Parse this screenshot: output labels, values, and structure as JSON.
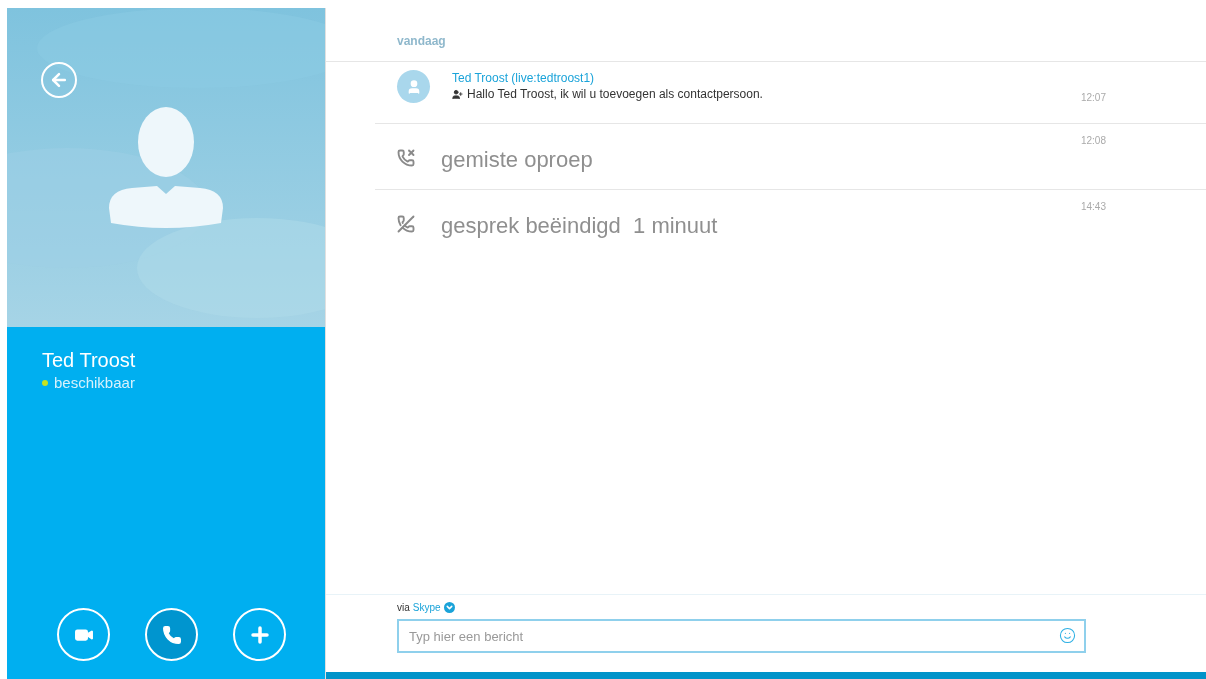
{
  "contact": {
    "name": "Ted Troost",
    "status": "beschikbaar",
    "available": true
  },
  "actions": [
    {
      "kind": "video",
      "selected": false
    },
    {
      "kind": "call",
      "selected": true
    },
    {
      "kind": "add",
      "selected": false
    }
  ],
  "day_label": "vandaag",
  "events": [
    {
      "kind": "message",
      "sender": "Ted Troost (live:tedtroost1)",
      "text": "Hallo Ted Troost, ik wil u toevoegen als contactpersoon.",
      "time": "12:07"
    },
    {
      "kind": "missed_call",
      "text": "gemiste oproep",
      "time": "12:08"
    },
    {
      "kind": "call_ended",
      "text": "gesprek beëindigd  1 minuut",
      "time": "14:43"
    }
  ],
  "composer": {
    "via": "via",
    "service": "Skype",
    "placeholder": "Typ hier een bericht"
  }
}
